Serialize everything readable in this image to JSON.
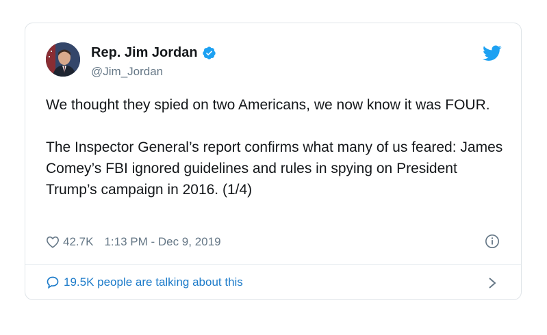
{
  "author": {
    "name": "Rep. Jim Jordan",
    "handle": "@Jim_Jordan"
  },
  "icons": {
    "brand": "twitter-bird-icon",
    "verified": "verified-badge-icon",
    "like": "heart-icon",
    "info": "info-icon",
    "reply": "speech-bubble-icon",
    "more": "chevron-right-icon"
  },
  "tweet": {
    "paragraph1": "We thought they spied on two Americans, we now know it was FOUR.",
    "paragraph2": "The Inspector General’s report confirms what many of us feared: James Comey’s FBI ignored guidelines and rules in spying on President Trump’s campaign in 2016. (1/4)"
  },
  "meta": {
    "likes": "42.7K",
    "timestamp": "1:13 PM - Dec 9, 2019"
  },
  "footer": {
    "talking": "19.5K people are talking about this"
  },
  "colors": {
    "twitter_blue": "#1da1f2",
    "link_blue": "#1b7ac9",
    "text": "#14171a",
    "muted": "#657786"
  }
}
